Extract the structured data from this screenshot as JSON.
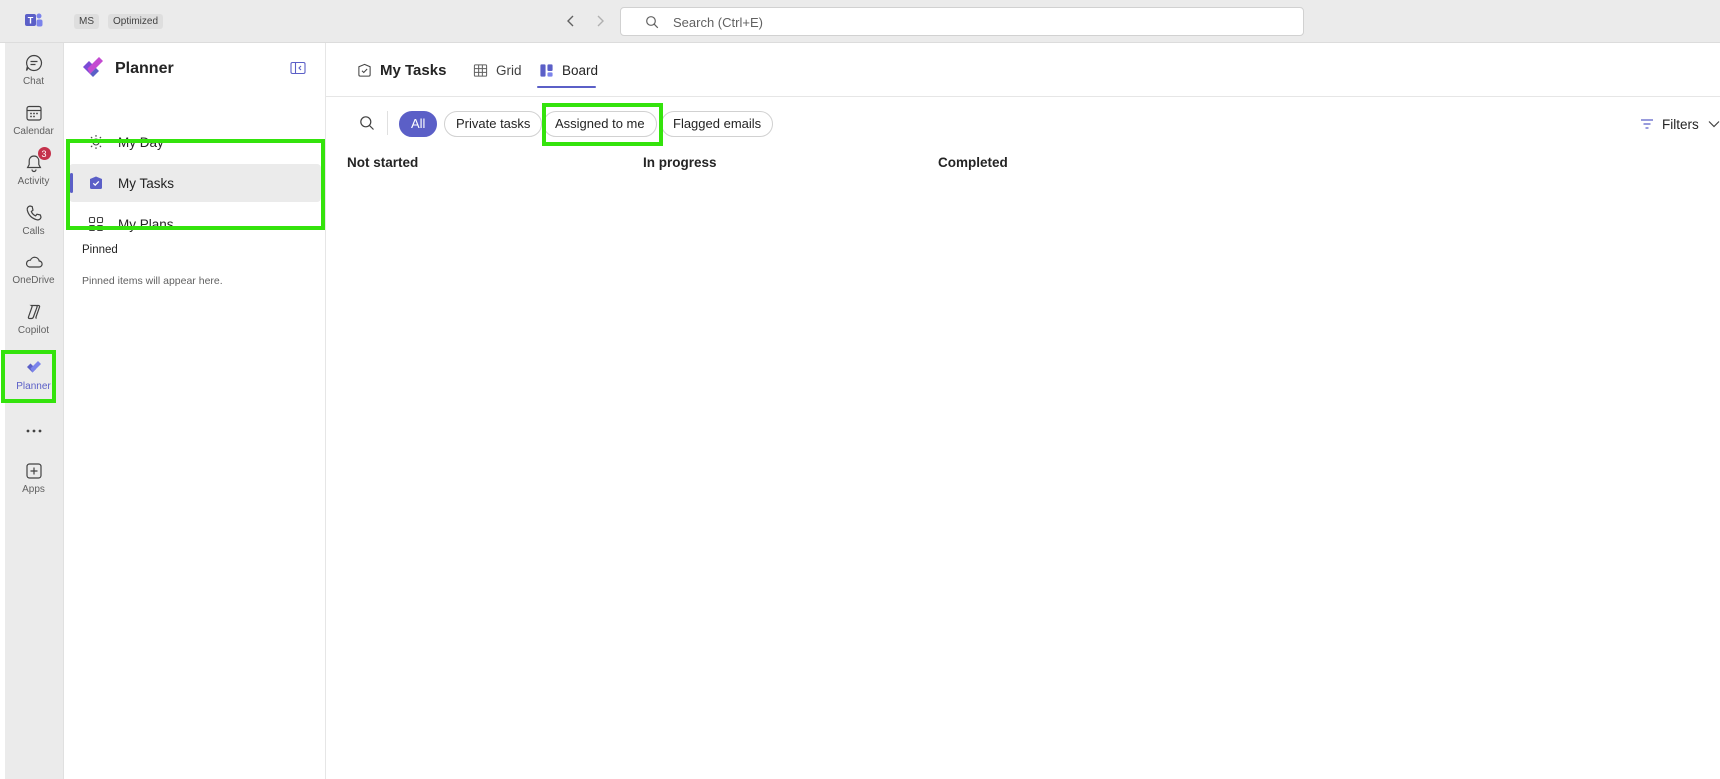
{
  "titlebar": {
    "chip_1": "MS",
    "chip_2": "Optimized",
    "search_placeholder": "Search (Ctrl+E)"
  },
  "rail": {
    "items": [
      {
        "label": "Chat",
        "icon": "chat-icon"
      },
      {
        "label": "Calendar",
        "icon": "calendar-icon"
      },
      {
        "label": "Activity",
        "icon": "bell-icon",
        "badge": "3"
      },
      {
        "label": "Calls",
        "icon": "phone-icon"
      },
      {
        "label": "OneDrive",
        "icon": "cloud-icon"
      },
      {
        "label": "Copilot",
        "icon": "copilot-icon"
      },
      {
        "label": "Planner",
        "icon": "planner-icon",
        "active": true
      },
      {
        "label": "Apps",
        "icon": "plus-box-icon"
      }
    ],
    "more_icon": "ellipsis-icon"
  },
  "sidebar": {
    "title": "Planner",
    "items": [
      {
        "label": "My Day",
        "icon": "sun-icon"
      },
      {
        "label": "My Tasks",
        "icon": "task-check-icon",
        "selected": true
      },
      {
        "label": "My Plans",
        "icon": "grid-icon"
      }
    ],
    "pinned_heading": "Pinned",
    "pinned_text": "Pinned items will appear here."
  },
  "main": {
    "tabs": [
      {
        "label": "My Tasks",
        "icon": "task-outline-icon"
      },
      {
        "label": "Grid",
        "icon": "table-icon"
      },
      {
        "label": "Board",
        "icon": "board-icon",
        "active": true
      }
    ],
    "filter_pills": [
      {
        "label": "All",
        "active": true
      },
      {
        "label": "Private tasks"
      },
      {
        "label": "Assigned to me"
      },
      {
        "label": "Flagged emails"
      }
    ],
    "filters_label": "Filters",
    "columns": [
      "Not started",
      "In progress",
      "Completed"
    ]
  },
  "colors": {
    "accent": "#5b5fc7",
    "highlight": "#34e30c",
    "badge": "#c4314b"
  }
}
